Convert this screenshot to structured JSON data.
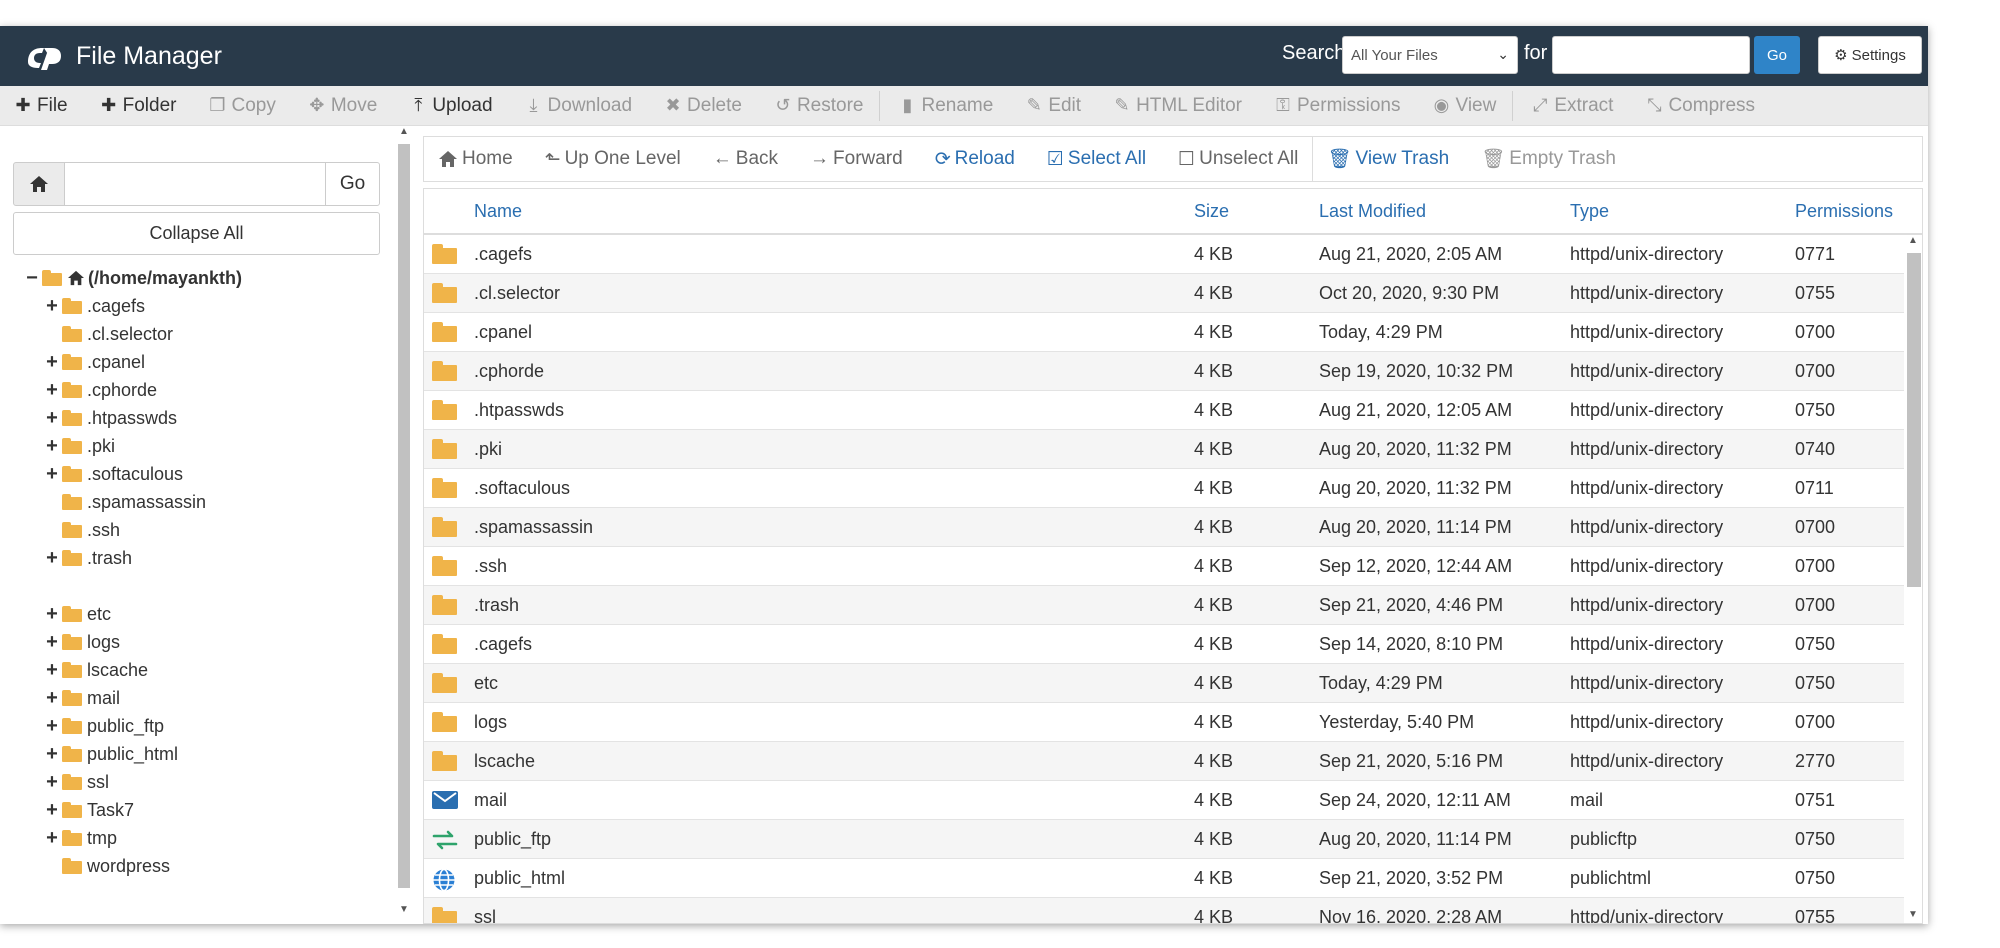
{
  "header": {
    "app_title": "File Manager",
    "search_label": "Search",
    "search_scope": "All Your Files",
    "for_label": "for",
    "search_value": "",
    "go_label": "Go",
    "settings_label": "Settings"
  },
  "toolbar": {
    "file": "File",
    "folder": "Folder",
    "copy": "Copy",
    "move": "Move",
    "upload": "Upload",
    "download": "Download",
    "delete": "Delete",
    "restore": "Restore",
    "rename": "Rename",
    "edit": "Edit",
    "html_editor": "HTML Editor",
    "permissions": "Permissions",
    "view": "View",
    "extract": "Extract",
    "compress": "Compress"
  },
  "left": {
    "path_value": "",
    "go_label": "Go",
    "collapse_all": "Collapse All",
    "root": "(/home/mayankth)",
    "tree": [
      {
        "name": ".cagefs",
        "expandable": true
      },
      {
        "name": ".cl.selector",
        "expandable": false
      },
      {
        "name": ".cpanel",
        "expandable": true
      },
      {
        "name": ".cphorde",
        "expandable": true
      },
      {
        "name": ".htpasswds",
        "expandable": true
      },
      {
        "name": ".pki",
        "expandable": true
      },
      {
        "name": ".softaculous",
        "expandable": true
      },
      {
        "name": ".spamassassin",
        "expandable": false
      },
      {
        "name": ".ssh",
        "expandable": false
      },
      {
        "name": ".trash",
        "expandable": true
      },
      {
        "name": "",
        "expandable": false
      },
      {
        "name": "etc",
        "expandable": true
      },
      {
        "name": "logs",
        "expandable": true
      },
      {
        "name": "lscache",
        "expandable": true
      },
      {
        "name": "mail",
        "expandable": true
      },
      {
        "name": "public_ftp",
        "expandable": true
      },
      {
        "name": "public_html",
        "expandable": true
      },
      {
        "name": "ssl",
        "expandable": true
      },
      {
        "name": "Task7",
        "expandable": true
      },
      {
        "name": "tmp",
        "expandable": true
      },
      {
        "name": "wordpress",
        "expandable": false
      }
    ]
  },
  "navbar": {
    "home": "Home",
    "up_one_level": "Up One Level",
    "back": "Back",
    "forward": "Forward",
    "reload": "Reload",
    "select_all": "Select All",
    "unselect_all": "Unselect All",
    "view_trash": "View Trash",
    "empty_trash": "Empty Trash"
  },
  "table": {
    "columns": [
      "Name",
      "Size",
      "Last Modified",
      "Type",
      "Permissions"
    ],
    "rows": [
      {
        "icon": "folder",
        "name": ".cagefs",
        "size": "4 KB",
        "modified": "Aug 21, 2020, 2:05 AM",
        "type": "httpd/unix-directory",
        "perms": "0771"
      },
      {
        "icon": "folder",
        "name": ".cl.selector",
        "size": "4 KB",
        "modified": "Oct 20, 2020, 9:30 PM",
        "type": "httpd/unix-directory",
        "perms": "0755"
      },
      {
        "icon": "folder",
        "name": ".cpanel",
        "size": "4 KB",
        "modified": "Today, 4:29 PM",
        "type": "httpd/unix-directory",
        "perms": "0700"
      },
      {
        "icon": "folder",
        "name": ".cphorde",
        "size": "4 KB",
        "modified": "Sep 19, 2020, 10:32 PM",
        "type": "httpd/unix-directory",
        "perms": "0700"
      },
      {
        "icon": "folder",
        "name": ".htpasswds",
        "size": "4 KB",
        "modified": "Aug 21, 2020, 12:05 AM",
        "type": "httpd/unix-directory",
        "perms": "0750"
      },
      {
        "icon": "folder",
        "name": ".pki",
        "size": "4 KB",
        "modified": "Aug 20, 2020, 11:32 PM",
        "type": "httpd/unix-directory",
        "perms": "0740"
      },
      {
        "icon": "folder",
        "name": ".softaculous",
        "size": "4 KB",
        "modified": "Aug 20, 2020, 11:32 PM",
        "type": "httpd/unix-directory",
        "perms": "0711"
      },
      {
        "icon": "folder",
        "name": ".spamassassin",
        "size": "4 KB",
        "modified": "Aug 20, 2020, 11:14 PM",
        "type": "httpd/unix-directory",
        "perms": "0700"
      },
      {
        "icon": "folder",
        "name": ".ssh",
        "size": "4 KB",
        "modified": "Sep 12, 2020, 12:44 AM",
        "type": "httpd/unix-directory",
        "perms": "0700"
      },
      {
        "icon": "folder",
        "name": ".trash",
        "size": "4 KB",
        "modified": "Sep 21, 2020, 4:46 PM",
        "type": "httpd/unix-directory",
        "perms": "0700"
      },
      {
        "icon": "folder",
        "name": ".cagefs",
        "size": "4 KB",
        "modified": "Sep 14, 2020, 8:10 PM",
        "type": "httpd/unix-directory",
        "perms": "0750"
      },
      {
        "icon": "folder",
        "name": "etc",
        "size": "4 KB",
        "modified": "Today, 4:29 PM",
        "type": "httpd/unix-directory",
        "perms": "0750"
      },
      {
        "icon": "folder",
        "name": "logs",
        "size": "4 KB",
        "modified": "Yesterday, 5:40 PM",
        "type": "httpd/unix-directory",
        "perms": "0700"
      },
      {
        "icon": "folder",
        "name": "lscache",
        "size": "4 KB",
        "modified": "Sep 21, 2020, 5:16 PM",
        "type": "httpd/unix-directory",
        "perms": "2770"
      },
      {
        "icon": "mail",
        "name": "mail",
        "size": "4 KB",
        "modified": "Sep 24, 2020, 12:11 AM",
        "type": "mail",
        "perms": "0751"
      },
      {
        "icon": "ftp",
        "name": "public_ftp",
        "size": "4 KB",
        "modified": "Aug 20, 2020, 11:14 PM",
        "type": "publicftp",
        "perms": "0750"
      },
      {
        "icon": "globe",
        "name": "public_html",
        "size": "4 KB",
        "modified": "Sep 21, 2020, 3:52 PM",
        "type": "publichtml",
        "perms": "0750"
      },
      {
        "icon": "folder",
        "name": "ssl",
        "size": "4 KB",
        "modified": "Nov 16, 2020, 2:28 AM",
        "type": "httpd/unix-directory",
        "perms": "0755"
      }
    ]
  },
  "colors": {
    "header_bg": "#293a4a",
    "accent_blue": "#2f84c8",
    "link_blue": "#2a6eb0",
    "folder": "#f0b449"
  }
}
